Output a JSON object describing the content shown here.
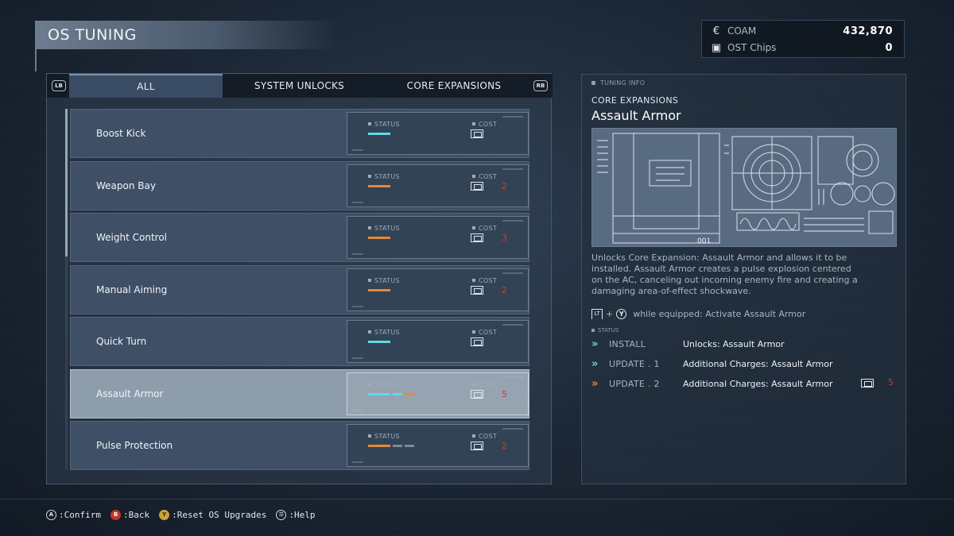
{
  "screen": {
    "title": "OS TUNING"
  },
  "currency": [
    {
      "icon": "coam-icon",
      "label": "COAM",
      "value": "432,870"
    },
    {
      "icon": "ost-chip-icon",
      "label": "OST Chips",
      "value": "0"
    }
  ],
  "tabs": {
    "lb": "LB",
    "rb": "RB",
    "items": [
      {
        "label": "ALL",
        "active": true
      },
      {
        "label": "SYSTEM UNLOCKS",
        "active": false
      },
      {
        "label": "CORE EXPANSIONS",
        "active": false
      }
    ]
  },
  "labels": {
    "status": "STATUS",
    "cost": "COST"
  },
  "items": [
    {
      "name": "Boost Kick",
      "cost": "",
      "selected": false,
      "bars": [
        {
          "color": "#5fd9e8",
          "size": "long"
        }
      ]
    },
    {
      "name": "Weapon Bay",
      "cost": "2",
      "selected": false,
      "bars": [
        {
          "color": "#e58a3c",
          "size": "long"
        }
      ]
    },
    {
      "name": "Weight Control",
      "cost": "3",
      "selected": false,
      "bars": [
        {
          "color": "#e58a3c",
          "size": "long"
        }
      ]
    },
    {
      "name": "Manual Aiming",
      "cost": "2",
      "selected": false,
      "bars": [
        {
          "color": "#e58a3c",
          "size": "long"
        }
      ]
    },
    {
      "name": "Quick Turn",
      "cost": "",
      "selected": false,
      "bars": [
        {
          "color": "#5fd9e8",
          "size": "long"
        }
      ]
    },
    {
      "name": "Assault Armor",
      "cost": "5",
      "selected": true,
      "bars": [
        {
          "color": "#5fd9e8",
          "size": "long"
        },
        {
          "color": "#5fd9e8",
          "size": "short"
        },
        {
          "color": "#e58a3c",
          "size": "short"
        }
      ]
    },
    {
      "name": "Pulse Protection",
      "cost": "2",
      "selected": false,
      "bars": [
        {
          "color": "#e58a3c",
          "size": "long"
        },
        {
          "color": "#7d8996",
          "size": "short"
        },
        {
          "color": "#7d8996",
          "size": "short"
        }
      ]
    }
  ],
  "detail": {
    "header": "TUNING INFO",
    "category": "CORE EXPANSIONS",
    "name": "Assault Armor",
    "description": "Unlocks Core Expansion: Assault Armor and allows it to be installed. Assault Armor creates a pulse explosion centered on the AC, canceling out incoming enemy fire and creating a damaging area-of-effect shockwave.",
    "control": {
      "trigger": "LT",
      "plus": "+",
      "button": "Y",
      "text": "while equipped: Activate Assault Armor"
    },
    "status_label": "STATUS",
    "schematic_number": "001",
    "upgrades": [
      {
        "status": "INSTALL",
        "description": "Unlocks: Assault Armor",
        "arrow_color": "#5fd9e8",
        "cost": ""
      },
      {
        "status": "UPDATE . 1",
        "description": "Additional Charges: Assault Armor",
        "arrow_color": "#5fd9e8",
        "cost": ""
      },
      {
        "status": "UPDATE . 2",
        "description": "Additional Charges: Assault Armor",
        "arrow_color": "#e58a3c",
        "cost": "5"
      }
    ]
  },
  "footer": [
    {
      "button": "A",
      "style": "",
      "label": ":Confirm"
    },
    {
      "button": "B",
      "style": "b",
      "label": ":Back"
    },
    {
      "button": "Y",
      "style": "y",
      "label": ":Reset OS Upgrades"
    },
    {
      "button": "☰",
      "style": "",
      "label": ":Help"
    }
  ]
}
